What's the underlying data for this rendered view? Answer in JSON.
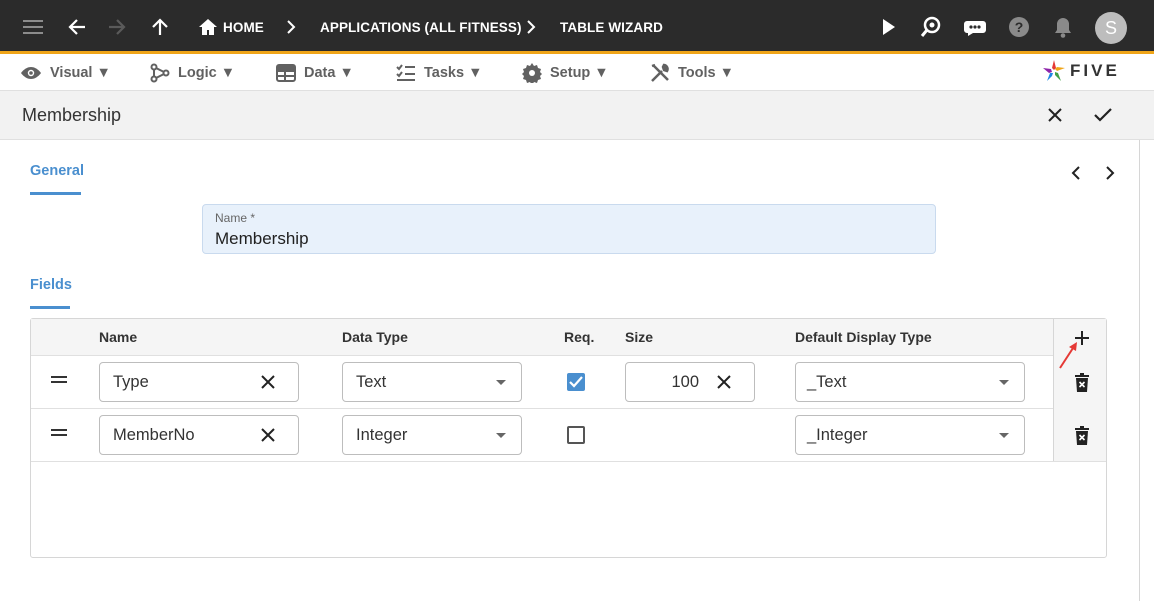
{
  "topbar": {
    "breadcrumbs": [
      "HOME",
      "APPLICATIONS (ALL FITNESS)",
      "TABLE WIZARD"
    ],
    "avatar_initial": "S"
  },
  "menu": {
    "items": [
      {
        "label": "Visual ▼",
        "icon": "eye-icon"
      },
      {
        "label": "Logic ▼",
        "icon": "logic-icon"
      },
      {
        "label": "Data ▼",
        "icon": "table-icon"
      },
      {
        "label": "Tasks ▼",
        "icon": "tasks-icon"
      },
      {
        "label": "Setup ▼",
        "icon": "gear-icon"
      },
      {
        "label": "Tools ▼",
        "icon": "tools-icon"
      }
    ],
    "logo_text": "FIVE"
  },
  "form": {
    "title": "Membership",
    "tabs": {
      "general": "General",
      "fields": "Fields"
    },
    "name_field": {
      "label": "Name *",
      "value": "Membership"
    }
  },
  "grid": {
    "columns": [
      "Name",
      "Data Type",
      "Req.",
      "Size",
      "Default Display Type"
    ],
    "rows": [
      {
        "name": "Type",
        "data_type": "Text",
        "required": true,
        "size": "100",
        "display_type": "_Text"
      },
      {
        "name": "MemberNo",
        "data_type": "Integer",
        "required": false,
        "size": "",
        "display_type": "_Integer"
      }
    ]
  },
  "colors": {
    "accent": "#4a8fcf",
    "topbar": "#2b2b2b",
    "topbar_border": "#f0a518",
    "annotation_arrow": "#e53935"
  }
}
